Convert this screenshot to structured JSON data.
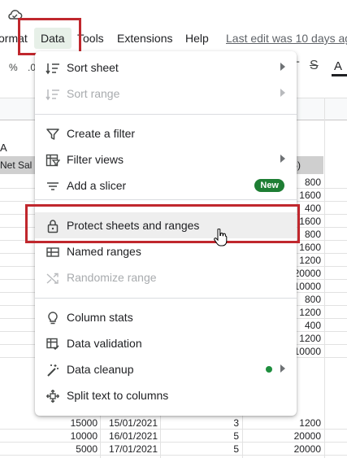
{
  "menubar": {
    "items": [
      "ormat",
      "Data",
      "Tools",
      "Extensions",
      "Help"
    ],
    "last_edit": "Last edit was 10 days ag"
  },
  "toolbar": {
    "percent": "%",
    "dec": ".0",
    "text_color": "A"
  },
  "sheet": {
    "cell_a": "A",
    "header_left": "Net Sal",
    "header_right": "S)",
    "right_values": [
      "800",
      "1600",
      "400",
      "1600",
      "800",
      "1600",
      "1200",
      "20000",
      "10000",
      "800",
      "1200",
      "400",
      "1200",
      "10000"
    ],
    "bottom_rows": [
      {
        "a": "15000",
        "b": "15/01/2021",
        "c": "3",
        "d": "1200"
      },
      {
        "a": "10000",
        "b": "16/01/2021",
        "c": "5",
        "d": "20000"
      },
      {
        "a": "5000",
        "b": "17/01/2021",
        "c": "5",
        "d": "20000"
      }
    ]
  },
  "data_menu": {
    "items": [
      {
        "label": "Sort sheet",
        "icon": "sort-icon",
        "disabled": false,
        "submenu": true
      },
      {
        "label": "Sort range",
        "icon": "sort-icon",
        "disabled": true,
        "submenu": true
      },
      {
        "label": "Create a filter",
        "icon": "filter-icon",
        "disabled": false,
        "submenu": false
      },
      {
        "label": "Filter views",
        "icon": "filter-views-icon",
        "disabled": false,
        "submenu": true
      },
      {
        "label": "Add a slicer",
        "icon": "slicer-icon",
        "disabled": false,
        "submenu": false,
        "badge": "New"
      },
      {
        "label": "Protect sheets and ranges",
        "icon": "lock-icon",
        "disabled": false,
        "submenu": false,
        "hovered": true
      },
      {
        "label": "Named ranges",
        "icon": "named-ranges-icon",
        "disabled": false,
        "submenu": false
      },
      {
        "label": "Randomize range",
        "icon": "shuffle-icon",
        "disabled": true,
        "submenu": false
      },
      {
        "label": "Column stats",
        "icon": "lightbulb-icon",
        "disabled": false,
        "submenu": false
      },
      {
        "label": "Data validation",
        "icon": "data-validation-icon",
        "disabled": false,
        "submenu": false
      },
      {
        "label": "Data cleanup",
        "icon": "magic-wand-icon",
        "disabled": false,
        "submenu": true,
        "dot": true
      },
      {
        "label": "Split text to columns",
        "icon": "split-icon",
        "disabled": false,
        "submenu": false
      }
    ]
  },
  "colors": {
    "highlight": "#c0272d",
    "new_badge": "#1e7e34",
    "menu_active": "#e7f0e8"
  }
}
